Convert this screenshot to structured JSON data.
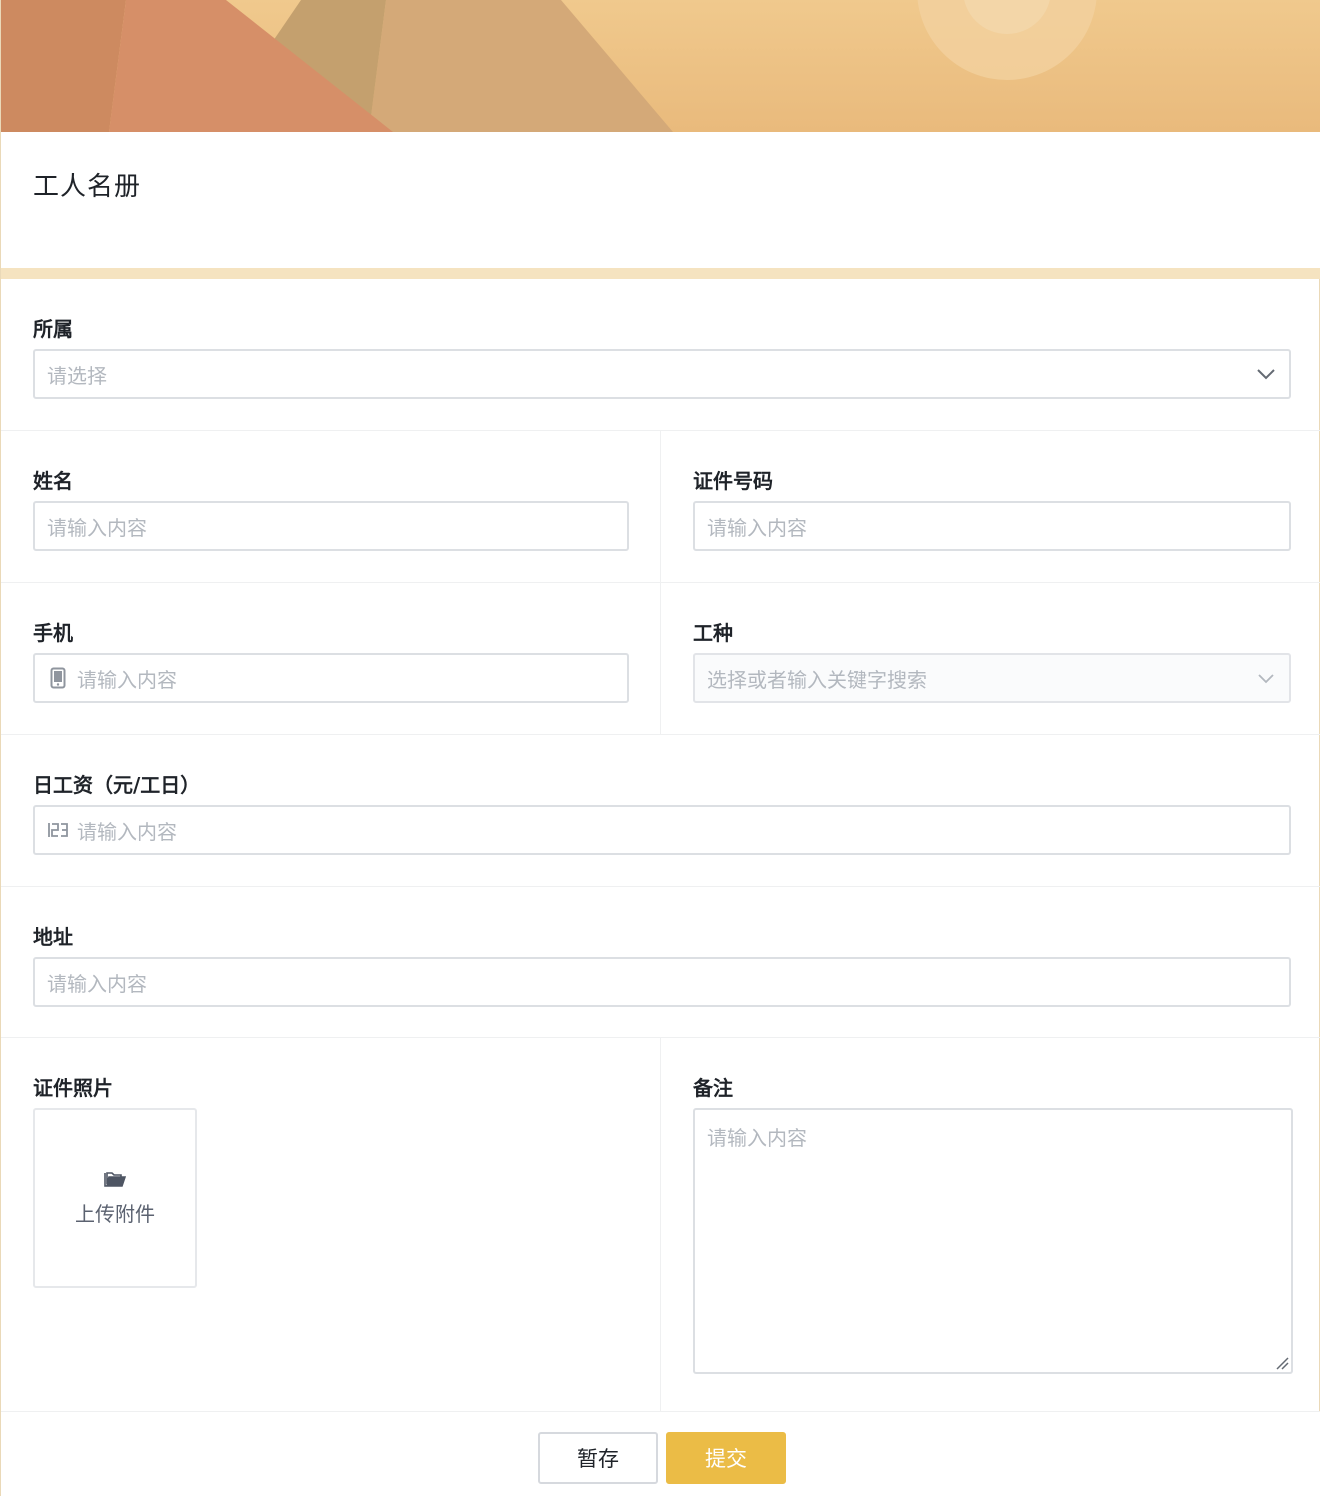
{
  "form": {
    "title": "工人名册",
    "accent_color": "#ebbc46"
  },
  "fields": {
    "affiliation": {
      "label": "所属",
      "placeholder": "请选择"
    },
    "name": {
      "label": "姓名",
      "placeholder": "请输入内容"
    },
    "id_number": {
      "label": "证件号码",
      "placeholder": "请输入内容"
    },
    "phone": {
      "label": "手机",
      "placeholder": "请输入内容",
      "icon": "mobile-phone-icon"
    },
    "job_type": {
      "label": "工种",
      "placeholder": "选择或者输入关键字搜索"
    },
    "daily_wage": {
      "label": "日工资（元/工日）",
      "placeholder": "请输入内容",
      "icon": "number-123-icon"
    },
    "address": {
      "label": "地址",
      "placeholder": "请输入内容"
    },
    "id_photo": {
      "label": "证件照片",
      "upload_label": "上传附件",
      "icon": "folder-icon"
    },
    "remarks": {
      "label": "备注",
      "placeholder": "请输入内容"
    }
  },
  "footer": {
    "save_label": "暂存",
    "submit_label": "提交"
  }
}
